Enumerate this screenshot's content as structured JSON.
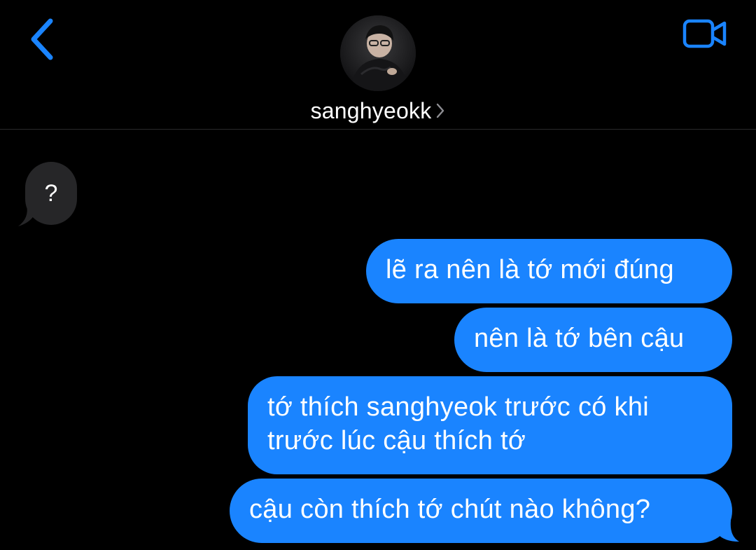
{
  "header": {
    "contact_name": "sanghyeokk"
  },
  "messages": [
    {
      "direction": "incoming",
      "text": "?"
    },
    {
      "direction": "outgoing",
      "text": "lẽ ra nên là tớ mới đúng"
    },
    {
      "direction": "outgoing",
      "text": "nên là tớ bên cậu"
    },
    {
      "direction": "outgoing",
      "lines": [
        "tớ thích sanghyeok trước có khi",
        "trước lúc cậu thích tớ"
      ]
    },
    {
      "direction": "outgoing",
      "text": "cậu còn thích tớ chút nào không?"
    }
  ],
  "icons": {
    "back": "chevron-left-icon",
    "video": "video-camera-icon",
    "name_chevron": "chevron-right-icon"
  },
  "colors": {
    "background": "#000000",
    "accent": "#1a84ff",
    "incoming_bubble": "#262628"
  }
}
